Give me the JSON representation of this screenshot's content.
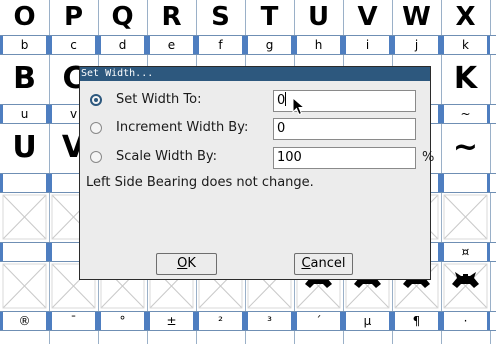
{
  "background": {
    "glyph_row_1": [
      "O",
      "P",
      "Q",
      "R",
      "S",
      "T",
      "U",
      "V",
      "W",
      "X"
    ],
    "label_row_1": [
      "b",
      "c",
      "d",
      "e",
      "f",
      "g",
      "h",
      "i",
      "j",
      "k"
    ],
    "glyph_row_2": [
      "B",
      "C",
      "",
      "",
      "",
      "",
      "",
      "",
      "",
      "K"
    ],
    "label_row_2": [
      "u",
      "v",
      "",
      "",
      "",
      "",
      "",
      "",
      "",
      "~"
    ],
    "glyph_row_3": [
      "U",
      "V",
      "",
      "",
      "",
      "",
      "",
      "",
      "",
      "~"
    ],
    "label_row_4_right": "¤",
    "label_row_5": [
      "®",
      "¯",
      "°",
      "±",
      "²",
      "³",
      "´",
      "µ",
      "¶",
      "·"
    ]
  },
  "dialog": {
    "title": "Set Width...",
    "options": [
      {
        "label": "Set Width To:",
        "value": "0",
        "selected": true
      },
      {
        "label": "Increment Width By:",
        "value": "0",
        "selected": false
      },
      {
        "label": "Scale Width By:",
        "value": "100",
        "selected": false
      }
    ],
    "percent_sign": "%",
    "note": "Left Side Bearing does not change.",
    "ok_label_mnemonic": "O",
    "ok_label_rest": "K",
    "cancel_label_mnemonic": "C",
    "cancel_label_rest": "ancel"
  },
  "colors": {
    "titlebar": "#2d587e",
    "dialog_bg": "#ececec",
    "label_bar_accent": "#4e7ec0"
  }
}
